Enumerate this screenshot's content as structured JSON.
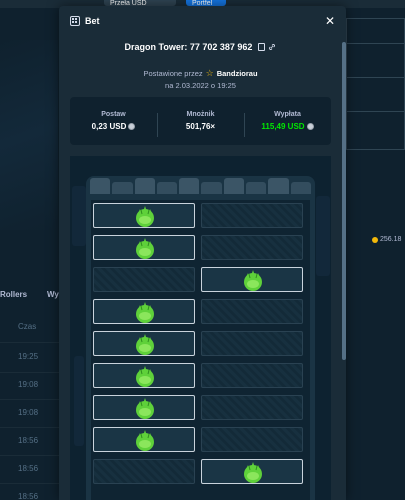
{
  "background": {
    "tabs": [
      "Rollers",
      "Wy"
    ],
    "column_header": "Czas",
    "times": [
      "19:25",
      "19:08",
      "19:08",
      "18:56",
      "18:56",
      "18:56"
    ],
    "badge": "256.18",
    "top_buttons": [
      "Przeła USD",
      "Portfel"
    ]
  },
  "modal": {
    "title": "Bet",
    "game_name": "Dragon Tower: 77 702 387 962",
    "placed_by_label": "Postawione przez",
    "username": "Bandziorau",
    "date": "na 2.03.2022 o 19:25",
    "stats": [
      {
        "label": "Postaw",
        "value": "0,23 USD"
      },
      {
        "label": "Mnożnik",
        "value": "501,76×"
      },
      {
        "label": "Wypłata",
        "value": "115,49 USD"
      }
    ]
  },
  "board": {
    "rows": [
      {
        "picked": "left"
      },
      {
        "picked": "left"
      },
      {
        "picked": "right"
      },
      {
        "picked": "left"
      },
      {
        "picked": "left"
      },
      {
        "picked": "left"
      },
      {
        "picked": "left"
      },
      {
        "picked": "left"
      },
      {
        "picked": "right"
      }
    ]
  },
  "colors": {
    "win": "#00e701",
    "accent": "#1475e1",
    "egg": "#5fd13a"
  }
}
